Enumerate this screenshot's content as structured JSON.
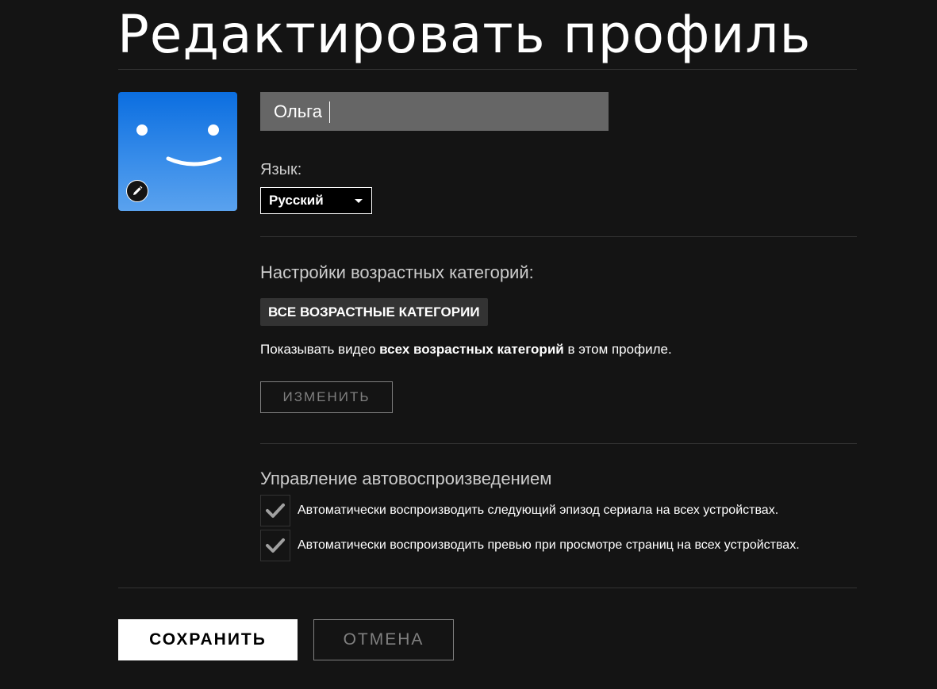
{
  "page": {
    "title": "Редактировать профиль"
  },
  "profile": {
    "avatar_icon": "smiley-face-icon",
    "avatar_color": "#0b6ee0",
    "edit_icon": "pencil-icon",
    "name_value": "Ольга"
  },
  "language": {
    "label": "Язык:",
    "selected": "Русский"
  },
  "maturity": {
    "heading": "Настройки возрастных категорий:",
    "badge": "ВСЕ ВОЗРАСТНЫЕ КАТЕГОРИИ",
    "desc_prefix": "Показывать видео ",
    "desc_bold": "всех возрастных категорий",
    "desc_suffix": " в этом профиле.",
    "edit_label": "ИЗМЕНИТЬ"
  },
  "autoplay": {
    "heading": "Управление автовоспроизведением",
    "options": [
      {
        "label": "Автоматически воспроизводить следующий эпизод сериала на всех устройствах.",
        "checked": true
      },
      {
        "label": "Автоматически воспроизводить превью при просмотре страниц на всех устройствах.",
        "checked": true
      }
    ]
  },
  "actions": {
    "save_label": "СОХРАНИТЬ",
    "cancel_label": "ОТМЕНА"
  }
}
